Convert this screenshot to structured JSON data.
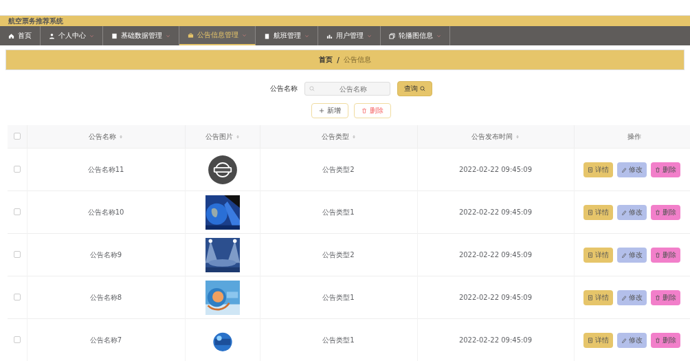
{
  "header": {
    "title": "航空票务推荐系统"
  },
  "nav": [
    {
      "label": "首页",
      "dropdown": false,
      "selected": false
    },
    {
      "label": "个人中心",
      "dropdown": true,
      "selected": false
    },
    {
      "label": "基础数据管理",
      "dropdown": true,
      "selected": false
    },
    {
      "label": "公告信息管理",
      "dropdown": true,
      "selected": true
    },
    {
      "label": "航班管理",
      "dropdown": true,
      "selected": false
    },
    {
      "label": "用户管理",
      "dropdown": true,
      "selected": false
    },
    {
      "label": "轮播图信息",
      "dropdown": true,
      "selected": false
    }
  ],
  "breadcrumb": [
    "首页",
    "/",
    "公告信息"
  ],
  "search": {
    "label": "公告名称",
    "placeholder": "公告名称",
    "button": "查询"
  },
  "actions": [
    {
      "kind": "add",
      "label": "新增"
    },
    {
      "kind": "delete",
      "label": "删除"
    }
  ],
  "table": {
    "select_all_checked": false,
    "columns": [
      {
        "label": "公告名称",
        "sortable": true
      },
      {
        "label": "公告图片",
        "sortable": true
      },
      {
        "label": "公告类型",
        "sortable": true
      },
      {
        "label": "公告发布时间",
        "sortable": true
      },
      {
        "label": "操作",
        "sortable": false
      }
    ],
    "rows": [
      {
        "checked": false,
        "name": "公告名称11",
        "type": "公告类型2",
        "time": "2022-02-22 09:45:09",
        "buttons": [
          {
            "kind": "detail",
            "label": "详情"
          },
          {
            "kind": "edit",
            "label": "修改"
          },
          {
            "kind": "delete",
            "label": "删除"
          }
        ]
      },
      {
        "checked": false,
        "name": "公告名称10",
        "type": "公告类型1",
        "time": "2022-02-22 09:45:09",
        "buttons": [
          {
            "kind": "detail",
            "label": "详情"
          },
          {
            "kind": "edit",
            "label": "修改"
          },
          {
            "kind": "delete",
            "label": "删除"
          }
        ]
      },
      {
        "checked": false,
        "name": "公告名称9",
        "type": "公告类型2",
        "time": "2022-02-22 09:45:09",
        "buttons": [
          {
            "kind": "detail",
            "label": "详情"
          },
          {
            "kind": "edit",
            "label": "修改"
          },
          {
            "kind": "delete",
            "label": "删除"
          }
        ]
      },
      {
        "checked": false,
        "name": "公告名称8",
        "type": "公告类型1",
        "time": "2022-02-22 09:45:09",
        "buttons": [
          {
            "kind": "detail",
            "label": "详情"
          },
          {
            "kind": "edit",
            "label": "修改"
          },
          {
            "kind": "delete",
            "label": "删除"
          }
        ]
      },
      {
        "checked": false,
        "name": "公告名称7",
        "type": "公告类型1",
        "time": "2022-02-22 09:45:09",
        "buttons": [
          {
            "kind": "detail",
            "label": "详情"
          },
          {
            "kind": "edit",
            "label": "修改"
          },
          {
            "kind": "delete",
            "label": "删除"
          }
        ]
      }
    ]
  }
}
